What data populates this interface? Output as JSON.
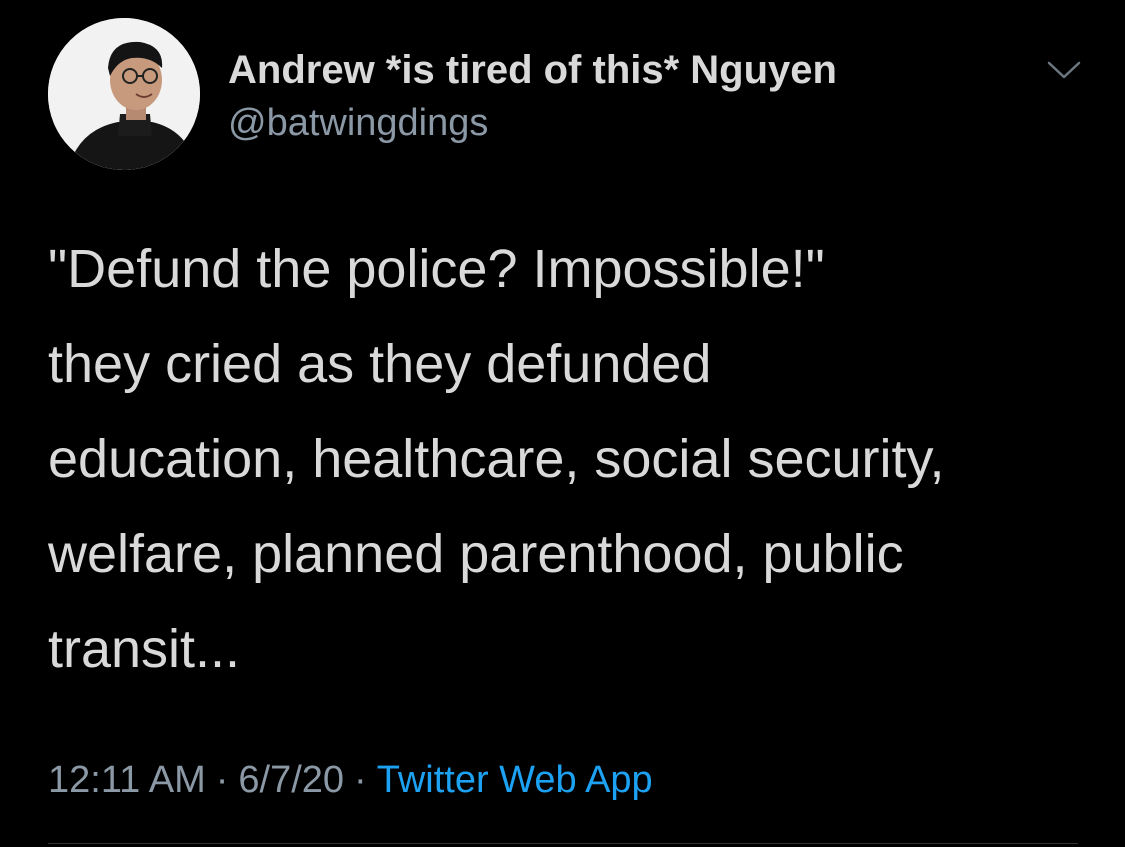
{
  "author": {
    "display_name": "Andrew *is tired of this* Nguyen",
    "handle": "@batwingdings",
    "avatar_icon": "profile-photo"
  },
  "menu": {
    "icon": "chevron-down-icon"
  },
  "tweet": {
    "lines": [
      "\"Defund the police? Impossible!\"",
      "they cried as they defunded",
      "education, healthcare, social security,",
      "welfare, planned parenthood, public",
      "transit..."
    ]
  },
  "meta": {
    "time": "12:11 AM",
    "separator": "·",
    "date": "6/7/20",
    "source": "Twitter Web App"
  },
  "colors": {
    "background": "#000000",
    "text": "#d9d9d9",
    "secondary": "#8b98a5",
    "link": "#1da1f2"
  }
}
